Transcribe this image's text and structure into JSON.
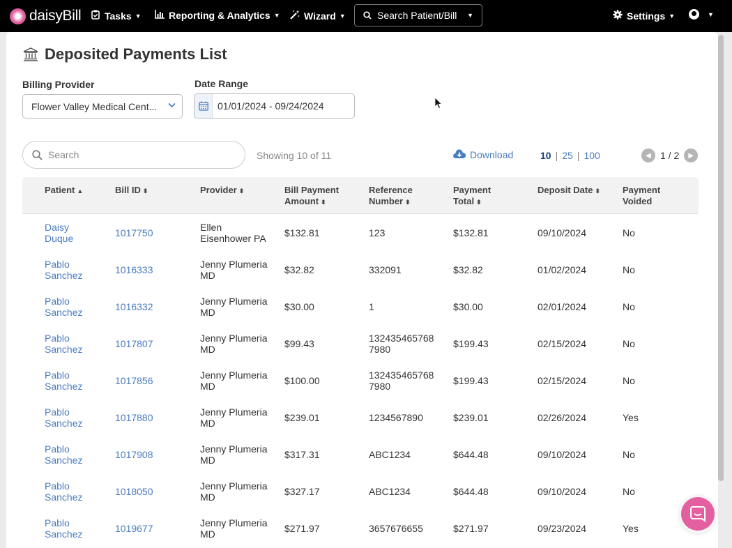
{
  "nav": {
    "logo_text": "daisyBill",
    "tasks": "Tasks",
    "reporting": "Reporting & Analytics",
    "wizard": "Wizard",
    "search": "Search Patient/Bill",
    "settings": "Settings"
  },
  "page": {
    "title": "Deposited Payments List",
    "billing_provider_label": "Billing Provider",
    "billing_provider_value": "Flower Valley Medical Cent...",
    "date_range_label": "Date Range",
    "date_range_value": "01/01/2024 - 09/24/2024"
  },
  "toolbar": {
    "search_placeholder": "Search",
    "showing": "Showing 10 of 11",
    "download": "Download",
    "page_sizes": [
      "10",
      "25",
      "100"
    ],
    "page_indicator": "1 / 2"
  },
  "table": {
    "headers": {
      "patient": "Patient",
      "bill_id": "Bill ID",
      "provider": "Provider",
      "bill_payment_amount_1": "Bill Payment",
      "bill_payment_amount_2": "Amount",
      "reference_number_1": "Reference",
      "reference_number_2": "Number",
      "payment_total_1": "Payment",
      "payment_total_2": "Total",
      "deposit_date": "Deposit Date",
      "payment_voided_1": "Payment",
      "payment_voided_2": "Voided"
    },
    "rows": [
      {
        "patient_1": "Daisy",
        "patient_2": "Duque",
        "bill_id": "1017750",
        "provider_1": "Ellen",
        "provider_2": "Eisenhower PA",
        "amount": "$132.81",
        "ref_1": "123",
        "ref_2": "",
        "total": "$132.81",
        "date": "09/10/2024",
        "voided": "No"
      },
      {
        "patient_1": "Pablo",
        "patient_2": "Sanchez",
        "bill_id": "1016333",
        "provider_1": "Jenny Plumeria",
        "provider_2": "MD",
        "amount": "$32.82",
        "ref_1": "332091",
        "ref_2": "",
        "total": "$32.82",
        "date": "01/02/2024",
        "voided": "No"
      },
      {
        "patient_1": "Pablo",
        "patient_2": "Sanchez",
        "bill_id": "1016332",
        "provider_1": "Jenny Plumeria",
        "provider_2": "MD",
        "amount": "$30.00",
        "ref_1": "1",
        "ref_2": "",
        "total": "$30.00",
        "date": "02/01/2024",
        "voided": "No"
      },
      {
        "patient_1": "Pablo",
        "patient_2": "Sanchez",
        "bill_id": "1017807",
        "provider_1": "Jenny Plumeria",
        "provider_2": "MD",
        "amount": "$99.43",
        "ref_1": "132435465768",
        "ref_2": "7980",
        "total": "$199.43",
        "date": "02/15/2024",
        "voided": "No"
      },
      {
        "patient_1": "Pablo",
        "patient_2": "Sanchez",
        "bill_id": "1017856",
        "provider_1": "Jenny Plumeria",
        "provider_2": "MD",
        "amount": "$100.00",
        "ref_1": "132435465768",
        "ref_2": "7980",
        "total": "$199.43",
        "date": "02/15/2024",
        "voided": "No"
      },
      {
        "patient_1": "Pablo",
        "patient_2": "Sanchez",
        "bill_id": "1017880",
        "provider_1": "Jenny Plumeria",
        "provider_2": "MD",
        "amount": "$239.01",
        "ref_1": "1234567890",
        "ref_2": "",
        "total": "$239.01",
        "date": "02/26/2024",
        "voided": "Yes"
      },
      {
        "patient_1": "Pablo",
        "patient_2": "Sanchez",
        "bill_id": "1017908",
        "provider_1": "Jenny Plumeria",
        "provider_2": "MD",
        "amount": "$317.31",
        "ref_1": "ABC1234",
        "ref_2": "",
        "total": "$644.48",
        "date": "09/10/2024",
        "voided": "No"
      },
      {
        "patient_1": "Pablo",
        "patient_2": "Sanchez",
        "bill_id": "1018050",
        "provider_1": "Jenny Plumeria",
        "provider_2": "MD",
        "amount": "$327.17",
        "ref_1": "ABC1234",
        "ref_2": "",
        "total": "$644.48",
        "date": "09/10/2024",
        "voided": "No"
      },
      {
        "patient_1": "Pablo",
        "patient_2": "Sanchez",
        "bill_id": "1019677",
        "provider_1": "Jenny Plumeria",
        "provider_2": "MD",
        "amount": "$271.97",
        "ref_1": "3657676655",
        "ref_2": "",
        "total": "$271.97",
        "date": "09/23/2024",
        "voided": "Yes"
      }
    ]
  },
  "colors": {
    "nav_bg": "#000000",
    "link": "#4a7cc0",
    "chat": "#e35fa0"
  }
}
